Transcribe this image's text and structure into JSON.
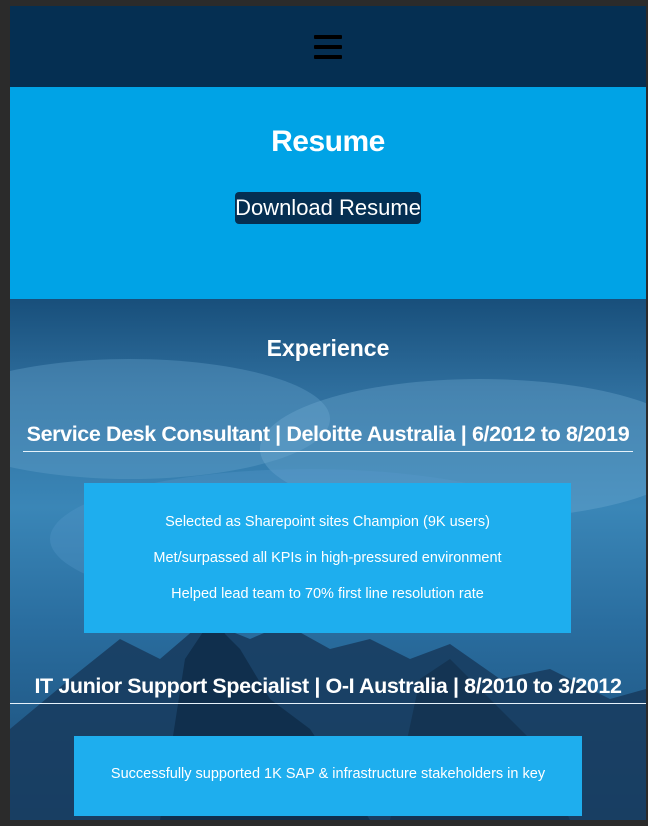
{
  "header": {
    "menu_icon": "hamburger-menu-icon"
  },
  "resume": {
    "title": "Resume",
    "download_label": "Download Resume"
  },
  "experience": {
    "heading": "Experience",
    "jobs": [
      {
        "title": "Service Desk Consultant | Deloitte Australia | 6/2012 to 8/2019",
        "items": [
          "Selected as Sharepoint sites Champion (9K users)",
          "Met/surpassed all KPIs in high-pressured environment",
          "Helped lead team to 70% first line resolution rate"
        ]
      },
      {
        "title": "IT Junior Support Specialist | O-I Australia | 8/2010 to 3/2012",
        "items": [
          "Successfully supported 1K SAP & infrastructure stakeholders in key"
        ]
      }
    ]
  },
  "colors": {
    "nav_bg": "#052f52",
    "accent": "#00a3e6",
    "card_bg": "#1eaeee",
    "text": "#ffffff"
  }
}
